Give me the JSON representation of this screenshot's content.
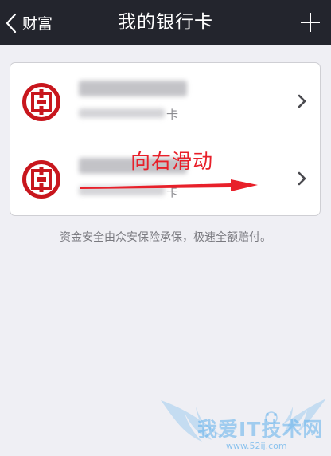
{
  "navbar": {
    "back_label": "财富",
    "title": "我的银行卡",
    "bg_color": "#23252d"
  },
  "cards": [
    {
      "bank_icon": "icbc-logo-icon",
      "name_blurred": true,
      "number_blurred": true,
      "suffix": "卡"
    },
    {
      "bank_icon": "icbc-logo-icon",
      "name_blurred": true,
      "number_blurred": true,
      "suffix": "卡"
    }
  ],
  "annotation": {
    "text": "向右滑动",
    "color": "#e8202a"
  },
  "footnote": "资金安全由众安保险承保，极速全额赔付。",
  "watermark": {
    "text": "我爱IT技术网",
    "url": "www.52ij.com"
  },
  "colors": {
    "brand_red": "#c8161d",
    "background": "#efeff4"
  }
}
